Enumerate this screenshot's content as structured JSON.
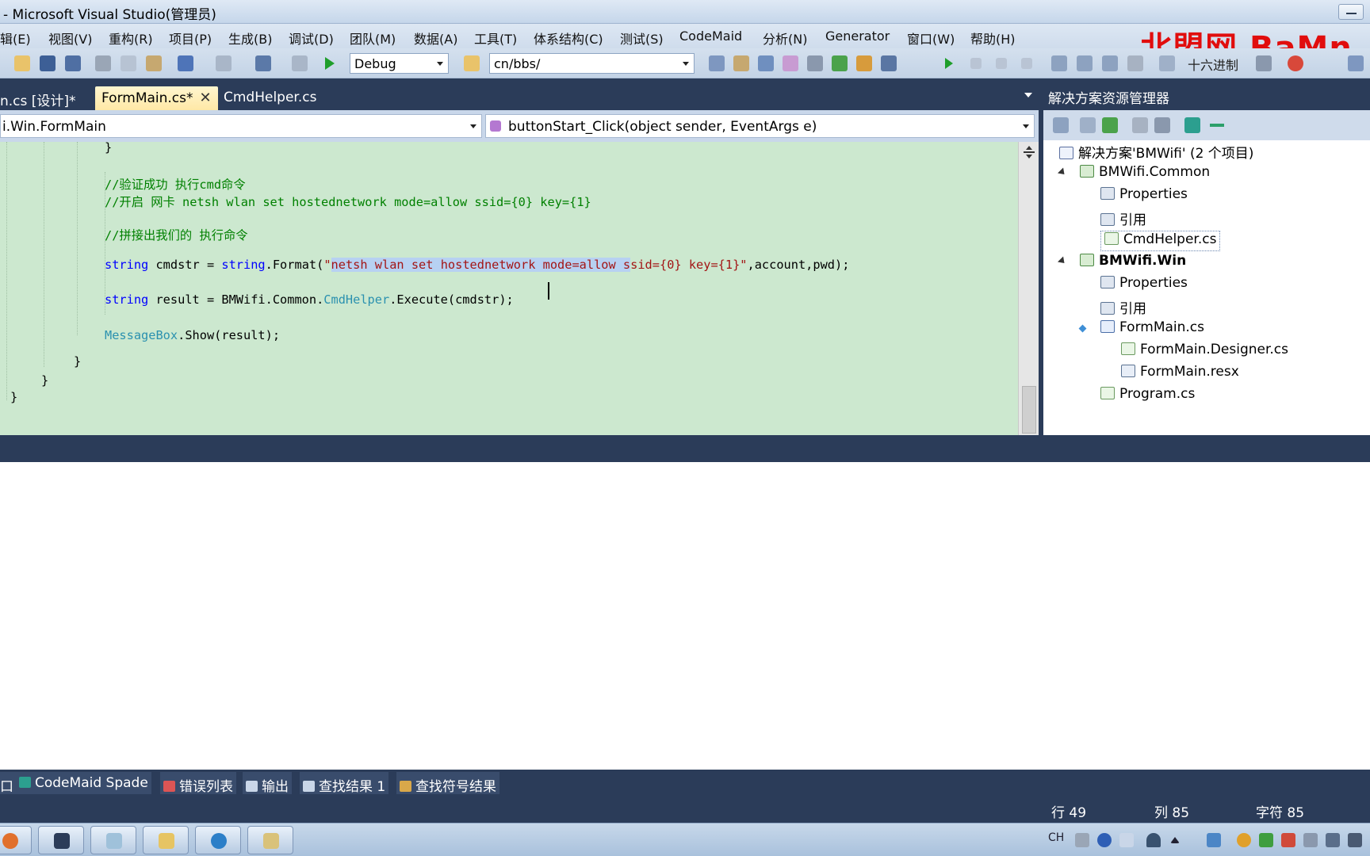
{
  "window": {
    "title": "- Microsoft Visual Studio(管理员)"
  },
  "watermark": "北盟网 BaMn.",
  "menu": [
    "辑(E)",
    "视图(V)",
    "重构(R)",
    "项目(P)",
    "生成(B)",
    "调试(D)",
    "团队(M)",
    "数据(A)",
    "工具(T)",
    "体系结构(C)",
    "测试(S)",
    "CodeMaid",
    "分析(N)",
    "Generator",
    "窗口(W)",
    "帮助(H)"
  ],
  "toolbar": {
    "config": "Debug",
    "find_path": "cn/bbs/",
    "hex_label": "十六进制"
  },
  "doc_tabs": [
    {
      "label": "n.cs [设计]*",
      "active": false
    },
    {
      "label": "FormMain.cs*",
      "active": true
    },
    {
      "label": "CmdHelper.cs",
      "active": false
    }
  ],
  "nav": {
    "type": "i.Win.FormMain",
    "member": "buttonStart_Click(object sender, EventArgs e)"
  },
  "code": {
    "l1": "}",
    "c1": "//验证成功 执行cmd命令",
    "c2": "//开启 网卡 netsh wlan set hostednetwork mode=allow ssid={0} key={1}",
    "c3": "//拼接出我们的 执行命令",
    "l4_kw1": "string",
    "l4_a": " cmdstr = ",
    "l4_kw2": "string",
    "l4_b": ".Format(",
    "l4_q": "\"",
    "l4_sel": "netsh wlan set hostednetwork mode=allow s",
    "l4_str": "sid={0} key={1}\"",
    "l4_c": ",account,pwd);",
    "l5_kw": "string",
    "l5_a": " result = BMWifi.Common.",
    "l5_ty": "CmdHelper",
    "l5_b": ".Execute(cmdstr);",
    "l6_ty": "MessageBox",
    "l6_b": ".Show(result);",
    "close2": "}",
    "close3": "}",
    "close4": "}"
  },
  "solution_explorer": {
    "title": "解决方案资源管理器",
    "items": [
      {
        "label": "解决方案'BMWifi' (2 个项目)"
      },
      {
        "label": "BMWifi.Common"
      },
      {
        "label": "Properties"
      },
      {
        "label": "引用"
      },
      {
        "label": "CmdHelper.cs"
      },
      {
        "label": "BMWifi.Win"
      },
      {
        "label": "Properties"
      },
      {
        "label": "引用"
      },
      {
        "label": "FormMain.cs"
      },
      {
        "label": "FormMain.Designer.cs"
      },
      {
        "label": "FormMain.resx"
      },
      {
        "label": "Program.cs"
      }
    ]
  },
  "tool_tabs": [
    "口",
    "CodeMaid Spade",
    "错误列表",
    "输出",
    "查找结果 1",
    "查找符号结果"
  ],
  "status": {
    "line": "行 49",
    "col": "列 85",
    "ch": "字符 85"
  },
  "tray": {
    "lang": "CH"
  }
}
